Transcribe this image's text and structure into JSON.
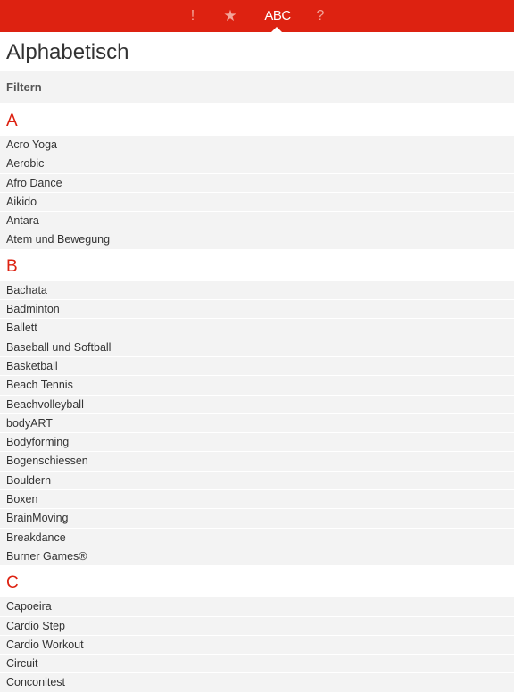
{
  "tabs": {
    "alert": "!",
    "favorites": "★",
    "alphabet": "ABC",
    "help": "?"
  },
  "page": {
    "title": "Alphabetisch",
    "filter_label": "Filtern"
  },
  "sections": [
    {
      "letter": "A",
      "items": [
        "Acro Yoga",
        "Aerobic",
        "Afro Dance",
        "Aikido",
        "Antara",
        "Atem und Bewegung"
      ]
    },
    {
      "letter": "B",
      "items": [
        "Bachata",
        "Badminton",
        "Ballett",
        "Baseball und Softball",
        "Basketball",
        "Beach Tennis",
        "Beachvolleyball",
        "bodyART",
        "Bodyforming",
        "Bogenschiessen",
        "Bouldern",
        "Boxen",
        "BrainMoving",
        "Breakdance",
        "Burner Games®"
      ]
    },
    {
      "letter": "C",
      "items": [
        "Capoeira",
        "Cardio Step",
        "Cardio Workout",
        "Circuit",
        "Conconitest"
      ]
    }
  ],
  "colors": {
    "accent": "#dd2211",
    "row_background": "#f3f3f3",
    "inactive_tab": "#f3a59a"
  }
}
